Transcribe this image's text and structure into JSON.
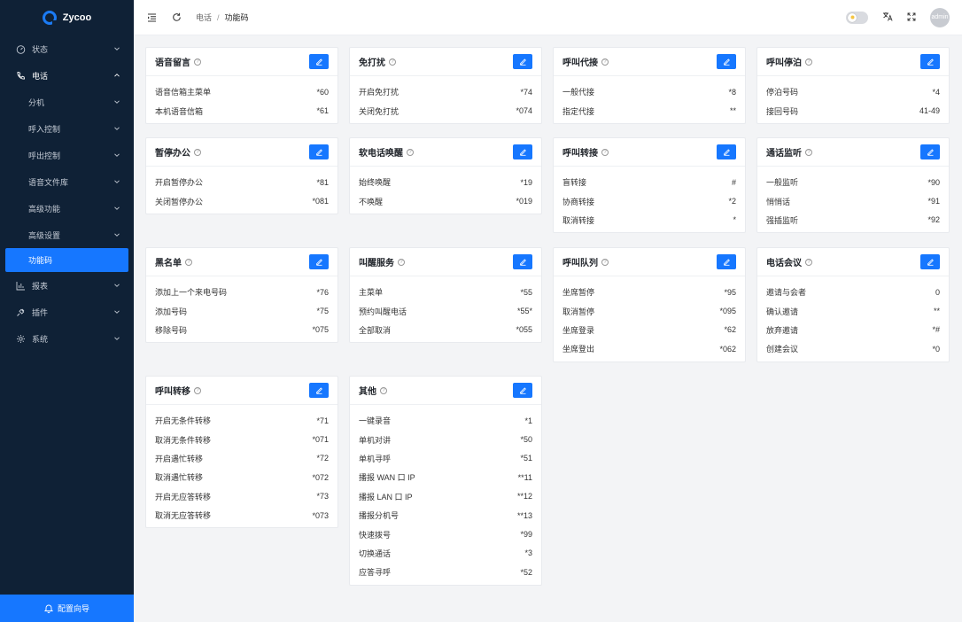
{
  "app": {
    "name": "Zycoo"
  },
  "sidebar": {
    "items": [
      {
        "label": "状态",
        "icon": "dashboard-icon"
      },
      {
        "label": "电话",
        "icon": "phone-icon",
        "open": true
      },
      {
        "label": "分机",
        "sub": true
      },
      {
        "label": "呼入控制",
        "sub": true
      },
      {
        "label": "呼出控制",
        "sub": true
      },
      {
        "label": "语音文件库",
        "sub": true
      },
      {
        "label": "高级功能",
        "sub": true
      },
      {
        "label": "高级设置",
        "sub": true
      },
      {
        "label": "功能码",
        "sub": true,
        "active": true
      },
      {
        "label": "报表",
        "icon": "chart-icon"
      },
      {
        "label": "插件",
        "icon": "plugin-icon"
      },
      {
        "label": "系统",
        "icon": "gear-icon"
      }
    ],
    "wizard_label": "配置向导"
  },
  "topbar": {
    "breadcrumb": [
      "电话",
      "功能码"
    ],
    "user": "admin"
  },
  "cards": [
    {
      "title": "语音留言",
      "rows": [
        [
          "语音信箱主菜单",
          "*60"
        ],
        [
          "本机语音信箱",
          "*61"
        ]
      ]
    },
    {
      "title": "免打扰",
      "rows": [
        [
          "开启免打扰",
          "*74"
        ],
        [
          "关闭免打扰",
          "*074"
        ]
      ]
    },
    {
      "title": "呼叫代接",
      "rows": [
        [
          "一般代接",
          "*8"
        ],
        [
          "指定代接",
          "**"
        ]
      ]
    },
    {
      "title": "呼叫停泊",
      "rows": [
        [
          "停泊号码",
          "*4"
        ],
        [
          "接回号码",
          "41-49"
        ]
      ]
    },
    {
      "title": "暂停办公",
      "rows": [
        [
          "开启暂停办公",
          "*81"
        ],
        [
          "关闭暂停办公",
          "*081"
        ]
      ]
    },
    {
      "title": "软电话唤醒",
      "rows": [
        [
          "始终唤醒",
          "*19"
        ],
        [
          "不唤醒",
          "*019"
        ]
      ]
    },
    {
      "title": "呼叫转接",
      "rows": [
        [
          "盲转接",
          "#"
        ],
        [
          "协商转接",
          "*2"
        ],
        [
          "取消转接",
          "*"
        ]
      ]
    },
    {
      "title": "通话监听",
      "rows": [
        [
          "一般监听",
          "*90"
        ],
        [
          "悄悄话",
          "*91"
        ],
        [
          "强插监听",
          "*92"
        ]
      ]
    },
    {
      "title": "黑名单",
      "rows": [
        [
          "添加上一个来电号码",
          "*76"
        ],
        [
          "添加号码",
          "*75"
        ],
        [
          "移除号码",
          "*075"
        ]
      ]
    },
    {
      "title": "叫醒服务",
      "rows": [
        [
          "主菜单",
          "*55"
        ],
        [
          "预约叫醒电话",
          "*55*"
        ],
        [
          "全部取消",
          "*055"
        ]
      ]
    },
    {
      "title": "呼叫队列",
      "rows": [
        [
          "坐席暂停",
          "*95"
        ],
        [
          "取消暂停",
          "*095"
        ],
        [
          "坐席登录",
          "*62"
        ],
        [
          "坐席登出",
          "*062"
        ]
      ]
    },
    {
      "title": "电话会议",
      "rows": [
        [
          "邀请与会者",
          "0"
        ],
        [
          "确认邀请",
          "**"
        ],
        [
          "放弃邀请",
          "*#"
        ],
        [
          "创建会议",
          "*0"
        ]
      ]
    },
    {
      "title": "呼叫转移",
      "rows": [
        [
          "开启无条件转移",
          "*71"
        ],
        [
          "取消无条件转移",
          "*071"
        ],
        [
          "开启遇忙转移",
          "*72"
        ],
        [
          "取消遇忙转移",
          "*072"
        ],
        [
          "开启无应答转移",
          "*73"
        ],
        [
          "取消无应答转移",
          "*073"
        ]
      ]
    },
    {
      "title": "其他",
      "rows": [
        [
          "一键录音",
          "*1"
        ],
        [
          "单机对讲",
          "*50"
        ],
        [
          "单机寻呼",
          "*51"
        ],
        [
          "播报 WAN 口 IP",
          "**11"
        ],
        [
          "播报 LAN 口 IP",
          "**12"
        ],
        [
          "播报分机号",
          "**13"
        ],
        [
          "快速拨号",
          "*99"
        ],
        [
          "切换通话",
          "*3"
        ],
        [
          "应答寻呼",
          "*52"
        ]
      ]
    }
  ]
}
